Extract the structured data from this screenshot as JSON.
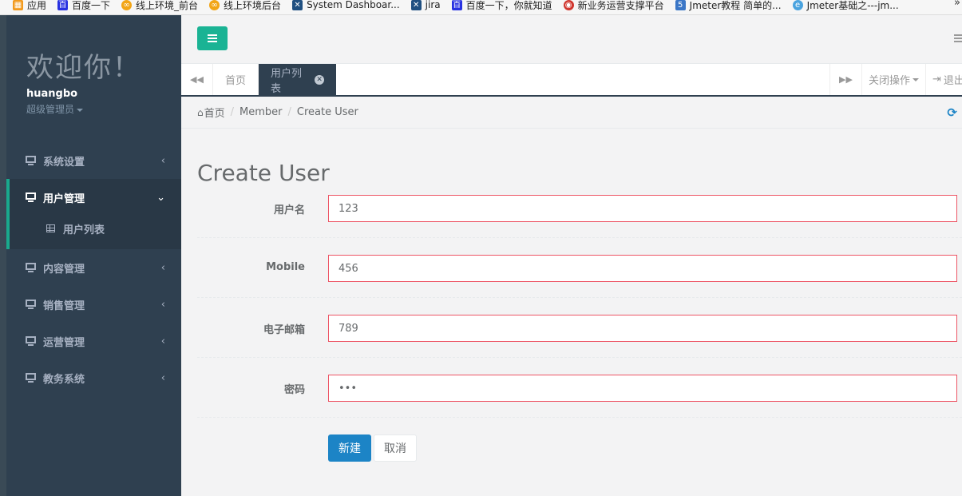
{
  "bookmarks": [
    {
      "label": "应用",
      "icon": "apps-icon",
      "color": "#f29a1d"
    },
    {
      "label": "百度一下",
      "icon": "baidu-icon",
      "color": "#2932e1"
    },
    {
      "label": "线上环境_前台",
      "icon": "site-icon",
      "color": "#f2a516"
    },
    {
      "label": "线上环境后台",
      "icon": "site-icon",
      "color": "#f2a516"
    },
    {
      "label": "System Dashboar...",
      "icon": "jira-icon",
      "color": "#205081"
    },
    {
      "label": "jira",
      "icon": "jira-icon",
      "color": "#205081"
    },
    {
      "label": "百度一下，你就知道",
      "icon": "baidu-icon",
      "color": "#2932e1"
    },
    {
      "label": "新业务运营支撑平台",
      "icon": "platform-icon",
      "color": "#d0352d"
    },
    {
      "label": "Jmeter教程 简单的...",
      "icon": "blog-icon",
      "color": "#3a76c6"
    },
    {
      "label": "Jmeter基础之---jm...",
      "icon": "browser-icon",
      "color": "#4aa3df"
    }
  ],
  "bookmarks_more": "»",
  "sidebar": {
    "welcome": "欢迎你！",
    "username": "huangbo",
    "role": "超级管理员",
    "items": [
      {
        "label": "系统设置",
        "chevron": "‹"
      },
      {
        "label": "用户管理",
        "chevron": "⌄"
      },
      {
        "label": "内容管理",
        "chevron": "‹"
      },
      {
        "label": "销售管理",
        "chevron": "‹"
      },
      {
        "label": "运营管理",
        "chevron": "‹"
      },
      {
        "label": "教务系统",
        "chevron": "‹"
      }
    ],
    "sub_item": "用户列表"
  },
  "tabs": {
    "back": "◀◀",
    "home": "首页",
    "active": "用户列表",
    "close_glyph": "✕",
    "forward": "▶▶",
    "close_ops": "关闭操作",
    "logout": "退出"
  },
  "breadcrumb": {
    "home": "首页",
    "sep": "/",
    "member": "Member",
    "current": "Create User"
  },
  "form": {
    "title": "Create User",
    "fields": [
      {
        "label": "用户名",
        "value": "123"
      },
      {
        "label": "Mobile",
        "value": "456"
      },
      {
        "label": "电子邮箱",
        "value": "789"
      },
      {
        "label": "密码",
        "value": "•••"
      }
    ],
    "create_label": "新建",
    "cancel_label": "取消"
  },
  "colors": {
    "sidebar_bg": "#2f4050",
    "accent": "#1ab394",
    "primary": "#1c84c6",
    "error_border": "#ed5565"
  }
}
